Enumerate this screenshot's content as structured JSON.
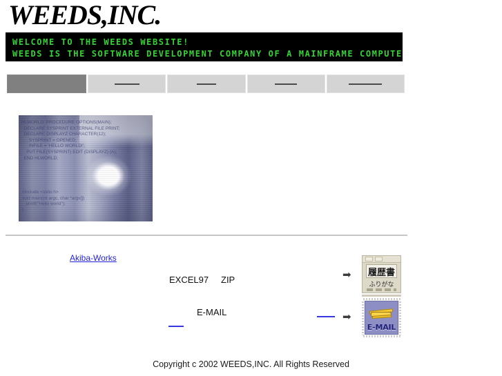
{
  "site": {
    "title": "WEEDS,INC."
  },
  "banner": {
    "line1": "WELCOME TO THE WEEDS WEBSITE!",
    "line2": "WEEDS IS THE SOFTWARE DEVELOPMENT COMPANY OF A MAINFRAME COMPUTER",
    "cursor": "█",
    "background_color": "#000000",
    "text_color": "#35d435"
  },
  "nav": {
    "items": [
      {
        "label": "",
        "state": "active",
        "width": 116
      },
      {
        "label": "",
        "state": "inactive",
        "width": 114
      },
      {
        "label": "",
        "state": "inactive",
        "width": 114
      },
      {
        "label": "",
        "state": "inactive",
        "width": 114
      },
      {
        "label": "",
        "state": "inactive",
        "width": 114
      }
    ],
    "active_color": "#808080",
    "inactive_color": "#d4d4d4"
  },
  "hero": {
    "alt": "brick corridor photo with overlaid source code",
    "tint_color": "#8b8fae",
    "code_upper": "HLWORLD: PROCEDURE OPTIONS(MAIN);\n  DECLARE SYSPRINT EXTERNAL FILE PRINT;\n  DECLARE DISPLAYZ CHARACTER(12);\n      SYSPRINT = OPENED;\n      INFILE = 'HELLO WORLD!';\n    PUT FILE(SYSPRINT) EDIT (DISPLAYZ) (A);\n  END HLWORLD;",
    "code_lower": "#include <stdio.h>\nvoid main(int argc, char *argv[])\n   printf(\"Hello world\");\n}"
  },
  "content": {
    "akiba_link": "Akiba-Works",
    "excel_label": "EXCEL97",
    "zip_label": "ZIP",
    "email_label": "E-MAIL",
    "link_stub_left": "",
    "link_stub_right": "",
    "arrow_glyph": "➡"
  },
  "icons": {
    "resume": {
      "title": "履歴書",
      "subtitle": "ふりがな",
      "name": "resume-icon"
    },
    "email": {
      "label": "E-MAIL",
      "name": "email-stamp-icon"
    }
  },
  "footer": {
    "copyright": "Copyright c 2002 WEEDS,INC. All Rights Reserved"
  }
}
